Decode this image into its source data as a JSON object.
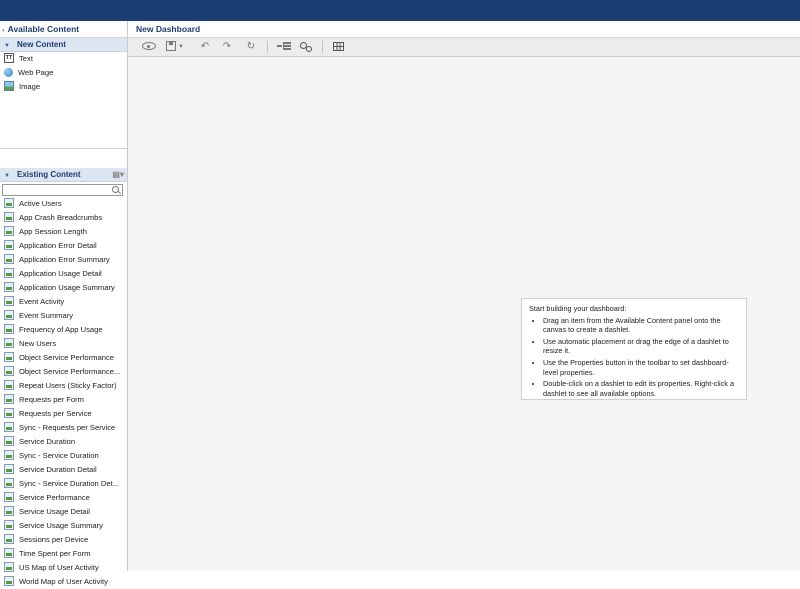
{
  "left_panel": {
    "title": "Available Content",
    "new_content": {
      "header": "New Content",
      "items": [
        {
          "label": "Text",
          "icon": "text-icon"
        },
        {
          "label": "Web Page",
          "icon": "globe-icon"
        },
        {
          "label": "Image",
          "icon": "image-icon"
        }
      ]
    },
    "existing_content": {
      "header": "Existing Content",
      "search": {
        "value": "",
        "placeholder": ""
      },
      "items": [
        "Active Users",
        "App Crash Breadcrumbs",
        "App Session Length",
        "Application Error Detail",
        "Application Error Summary",
        "Application Usage Detail",
        "Application Usage Summary",
        "Event Activity",
        "Event Summary",
        "Frequency of App Usage",
        "New Users",
        "Object Service Performance",
        "Object Service Performance...",
        "Repeat Users (Sticky Factor)",
        "Requests per Form",
        "Requests per Service",
        "Sync - Requests per Service",
        "Service Duration",
        "Sync - Service Duration",
        "Service Duration Detail",
        "Sync - Service Duration Det...",
        "Service Performance",
        "Service Usage Detail",
        "Service Usage Summary",
        "Sessions per Device",
        "Time Spent per Form",
        "US Map of User Activity",
        "World Map of User Activity"
      ]
    }
  },
  "main": {
    "title": "New Dashboard",
    "help": {
      "heading": "Start building your dashboard:",
      "tips": [
        "Drag an item from the Available Content panel onto the canvas to create a dashlet.",
        "Use automatic placement or drag the edge of a dashlet to resize it.",
        "Use the Properties button in the toolbar to set dashboard-level properties.",
        "Double-click on a dashlet to edit its properties. Right-click a dashlet to see all available options."
      ]
    }
  },
  "colors": {
    "top_bar": "#1b3f75",
    "section_header_bg": "#dce6f2",
    "title_text": "#1e3d6e",
    "canvas_bg": "#f5f5f5"
  }
}
